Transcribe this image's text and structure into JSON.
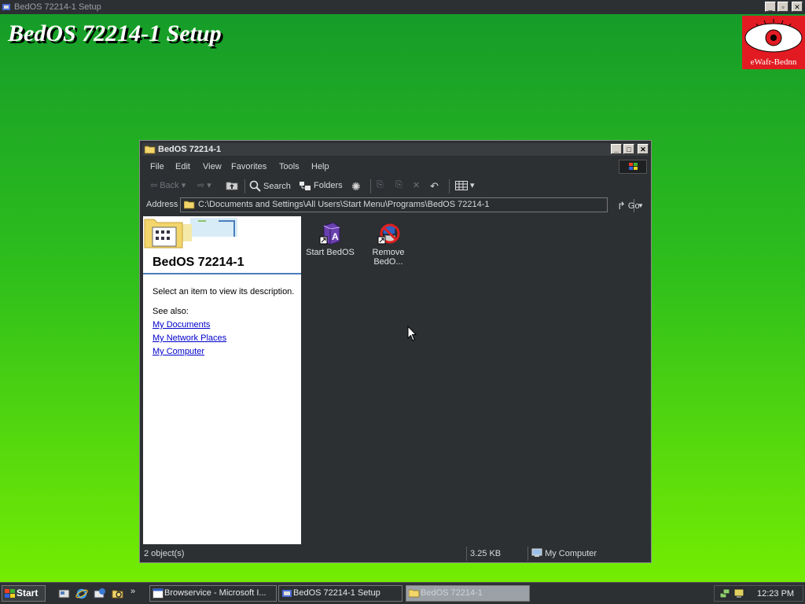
{
  "setup": {
    "window_title": "BedOS 72214-1 Setup",
    "heading": "BedOS 72214-1 Setup",
    "logo_text": "eWafr-Bednn"
  },
  "window": {
    "title": "BedOS 72214-1",
    "menu": [
      "File",
      "Edit",
      "View",
      "Favorites",
      "Tools",
      "Help"
    ],
    "toolbar": {
      "back": "Back",
      "search": "Search",
      "folders": "Folders"
    },
    "address": {
      "label": "Address",
      "value": "C:\\Documents and Settings\\All Users\\Start Menu\\Programs\\BedOS 72214-1",
      "go": "Go"
    },
    "left_pane": {
      "title": "BedOS 72214-1",
      "description": "Select an item to view its description.",
      "see_also": "See also:",
      "links": [
        "My Documents",
        "My Network Places",
        "My Computer"
      ]
    },
    "files": [
      {
        "line1": "Start BedOS",
        "line2": ""
      },
      {
        "line1": "Remove",
        "line2": "BedO..."
      }
    ],
    "status": {
      "objects": "2 object(s)",
      "size": "3.25 KB",
      "zone": "My Computer"
    }
  },
  "taskbar": {
    "start": "Start",
    "tasks": [
      "Browservice - Microsoft I...",
      "BedOS 72214-1 Setup",
      "BedOS 72214-1"
    ],
    "clock": "12:23 PM"
  },
  "colors": {
    "desktop_top": "#149a2a",
    "desktop_bottom": "#79f000",
    "window_bg": "#2d3033",
    "logo_red": "#e21b22",
    "link_blue": "#0000cc"
  }
}
